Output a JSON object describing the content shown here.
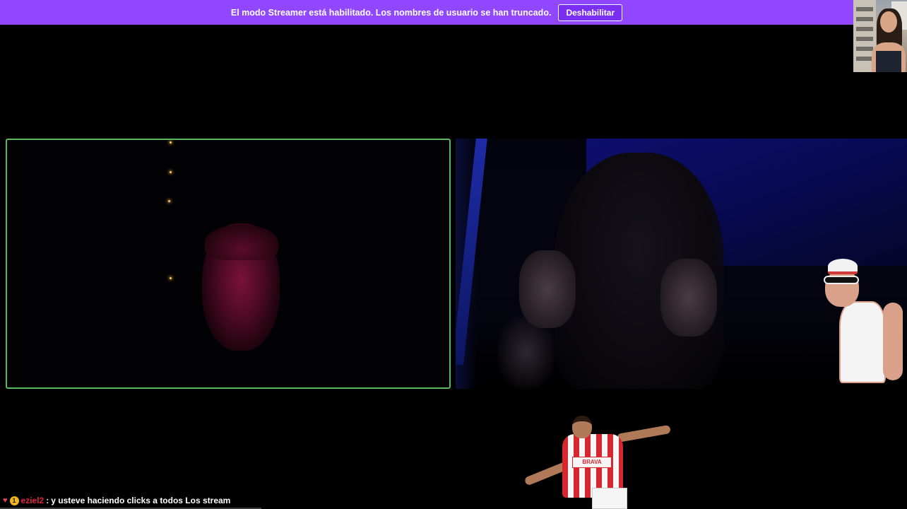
{
  "streamer_banner": {
    "message": "El modo Streamer está habilitado. Los nombres de usuario se han truncado.",
    "button_label": "Deshabilitar"
  },
  "sticker_player": {
    "shirt_text": "BRAVA"
  },
  "chat": {
    "badge": "1",
    "username": "eziel2",
    "separator": ":",
    "message": "y usteve haciendo clicks a todos Los stream"
  },
  "colors": {
    "banner": "#9147ff",
    "active_camera_border": "#5cb85c",
    "chat_username": "#e0243a"
  },
  "icons": {
    "chat_heart": "heart-icon",
    "chat_badge": "subscriber-badge-icon"
  }
}
